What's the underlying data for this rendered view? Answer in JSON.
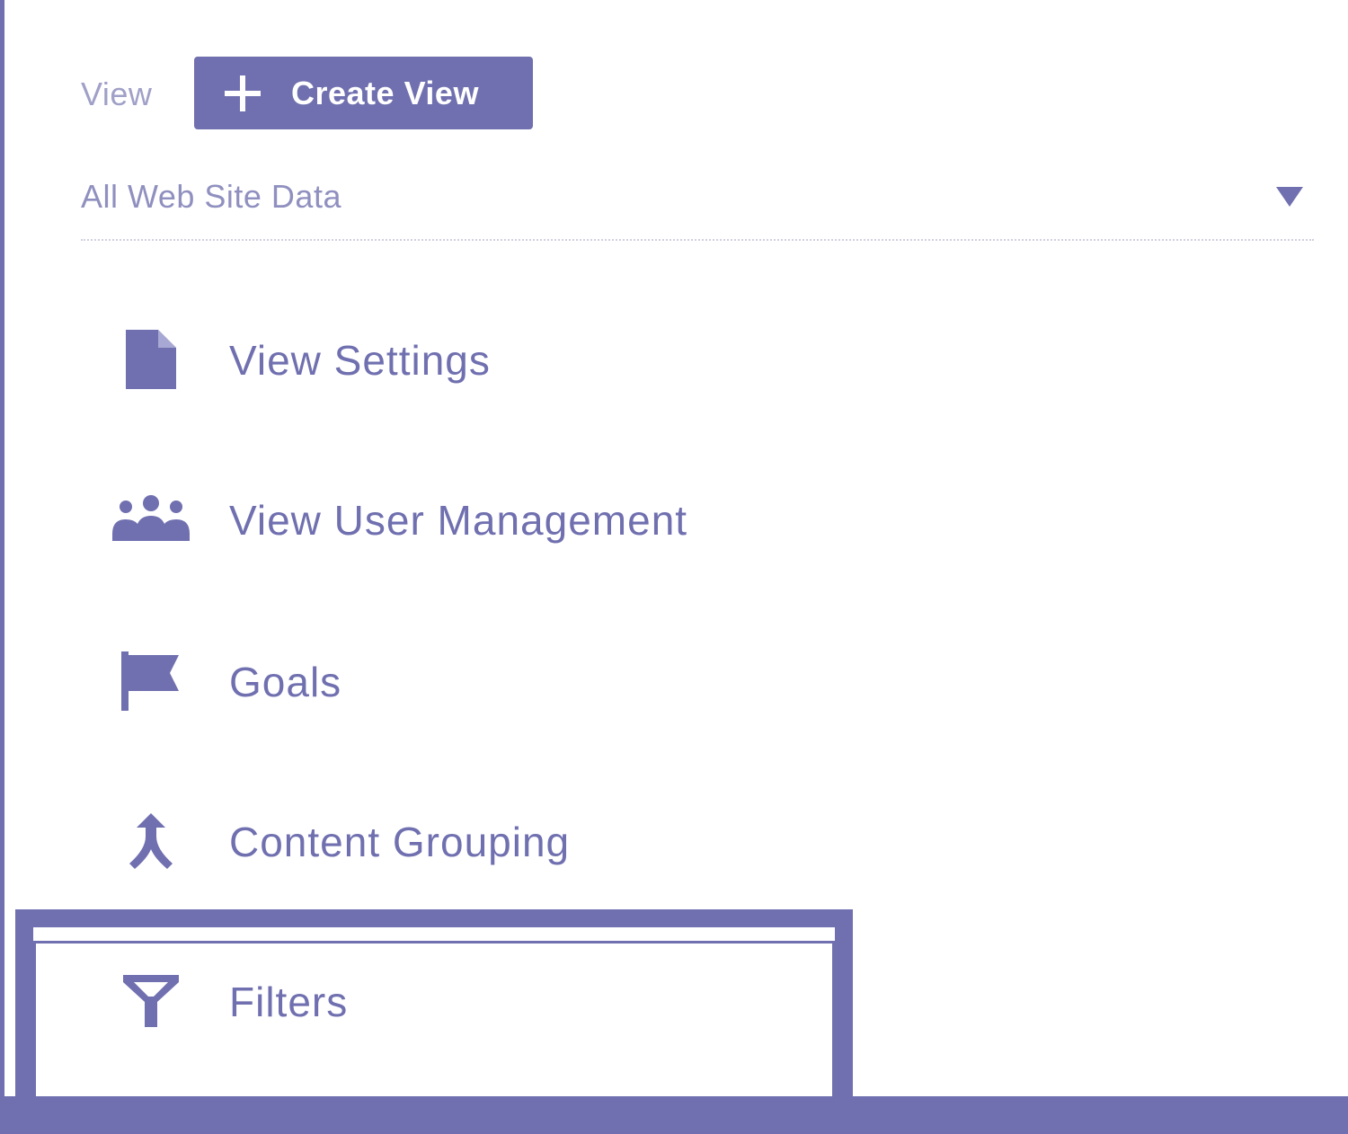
{
  "view_section": {
    "label": "View",
    "create_button_label": "Create View",
    "selected_view": "All Web Site Data"
  },
  "menu": [
    {
      "label": "View Settings",
      "icon": "document-icon"
    },
    {
      "label": "View User Management",
      "icon": "users-icon"
    },
    {
      "label": "Goals",
      "icon": "flag-icon"
    },
    {
      "label": "Content Grouping",
      "icon": "merge-icon"
    },
    {
      "label": "Filters",
      "icon": "filter-icon"
    }
  ],
  "colors": {
    "accent": "#7070b0",
    "muted_text": "#a0a0c8",
    "background": "#ffffff"
  }
}
